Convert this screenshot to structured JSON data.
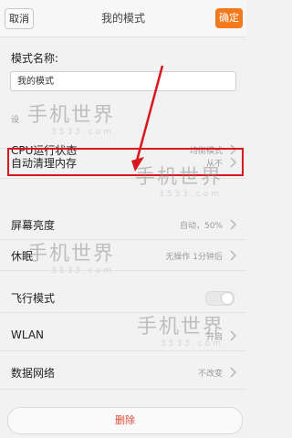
{
  "header": {
    "cancel_label": "取消",
    "title": "我的模式",
    "ok_label": "确定"
  },
  "mode_name": {
    "label": "模式名称:",
    "value": "我的模式"
  },
  "section_label": "设",
  "settings": [
    {
      "label": "CPU运行状态",
      "value": "均衡模式",
      "type": "chevron"
    },
    {
      "label": "自动清理内存",
      "value": "从不",
      "type": "chevron"
    },
    {
      "label": "屏幕亮度",
      "value": "自动，50%",
      "type": "chevron"
    },
    {
      "label": "休眠",
      "value": "无操作 1分钟后",
      "type": "chevron"
    },
    {
      "label": "飞行模式",
      "value": "",
      "type": "toggle",
      "toggle_on": false
    },
    {
      "label": "WLAN",
      "value": "开启",
      "type": "chevron"
    },
    {
      "label": "数据网络",
      "value": "不改变",
      "type": "chevron"
    }
  ],
  "delete_label": "删除",
  "watermark": {
    "text": "手机世界",
    "number": "3533.com"
  },
  "colors": {
    "accent": "#f27a1d",
    "highlight": "#d8181e",
    "delete": "#e04a3b"
  }
}
